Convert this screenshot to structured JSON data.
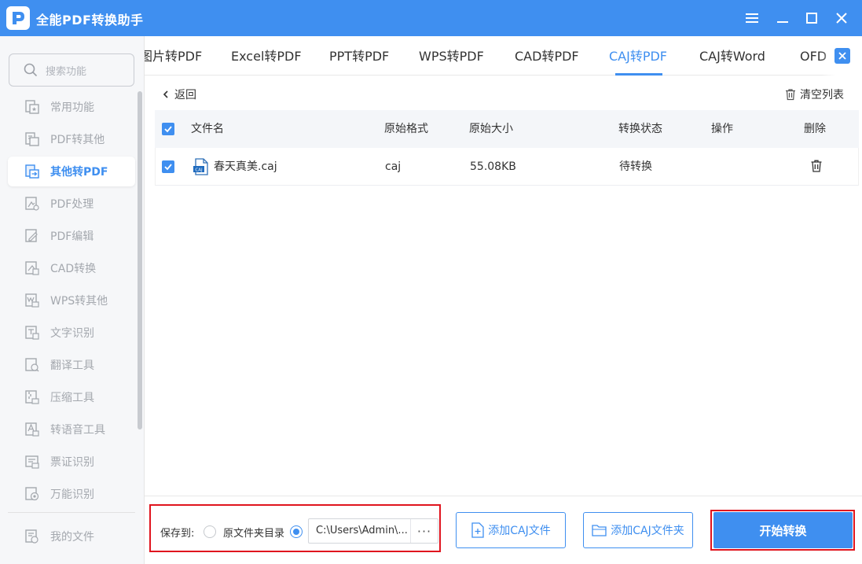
{
  "app": {
    "title": "全能PDF转换助手"
  },
  "search": {
    "placeholder": "搜索功能"
  },
  "sidebar": {
    "items": [
      {
        "label": "常用功能",
        "icon": "star-doc-icon"
      },
      {
        "label": "PDF转其他",
        "icon": "pdf-export-icon"
      },
      {
        "label": "其他转PDF",
        "icon": "pdf-import-icon",
        "active": true
      },
      {
        "label": "PDF处理",
        "icon": "pdf-process-icon"
      },
      {
        "label": "PDF编辑",
        "icon": "pdf-edit-icon"
      },
      {
        "label": "CAD转换",
        "icon": "cad-icon"
      },
      {
        "label": "WPS转其他",
        "icon": "wps-icon"
      },
      {
        "label": "文字识别",
        "icon": "ocr-icon"
      },
      {
        "label": "翻译工具",
        "icon": "translate-icon"
      },
      {
        "label": "压缩工具",
        "icon": "compress-icon"
      },
      {
        "label": "转语音工具",
        "icon": "speech-icon"
      },
      {
        "label": "票证识别",
        "icon": "ticket-icon"
      },
      {
        "label": "万能识别",
        "icon": "scan-icon"
      }
    ],
    "my_files": "我的文件"
  },
  "tabs": [
    {
      "label": "图片转PDF"
    },
    {
      "label": "Excel转PDF"
    },
    {
      "label": "PPT转PDF"
    },
    {
      "label": "WPS转PDF"
    },
    {
      "label": "CAD转PDF"
    },
    {
      "label": "CAJ转PDF",
      "active": true
    },
    {
      "label": "CAJ转Word"
    },
    {
      "label": "OFD"
    }
  ],
  "toolbar": {
    "back": "返回",
    "clear": "清空列表"
  },
  "table": {
    "headers": {
      "name": "文件名",
      "format": "原始格式",
      "size": "原始大小",
      "status": "转换状态",
      "action": "操作",
      "delete": "删除"
    },
    "rows": [
      {
        "name": "春天真美.caj",
        "format": "caj",
        "size": "55.08KB",
        "status": "待转换",
        "icon_text": "CAJ",
        "checked": true
      }
    ]
  },
  "save": {
    "label": "保存到:",
    "option_original": "原文件夹目录",
    "path": "C:\\Users\\Admin\\..."
  },
  "buttons": {
    "add_file": "添加CAJ文件",
    "add_folder": "添加CAJ文件夹",
    "start": "开始转换"
  },
  "colors": {
    "accent": "#3f8ff0",
    "highlight": "#e0141e"
  }
}
